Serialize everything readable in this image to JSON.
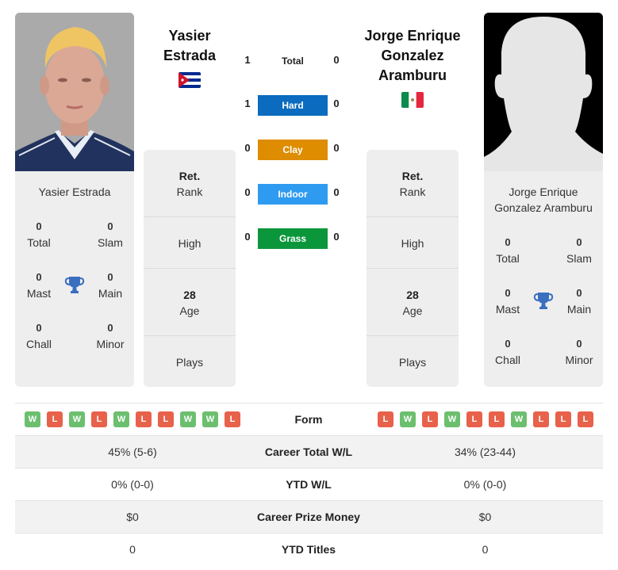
{
  "player1": {
    "name_header": "Yasier Estrada",
    "name_line1": "Yasier",
    "name_line2": "Estrada",
    "card_name": "Yasier Estrada",
    "country_flag": "cuba-flag",
    "titles": {
      "total": {
        "value": "0",
        "label": "Total"
      },
      "slam": {
        "value": "0",
        "label": "Slam"
      },
      "mast": {
        "value": "0",
        "label": "Mast"
      },
      "main": {
        "value": "0",
        "label": "Main"
      },
      "chall": {
        "value": "0",
        "label": "Chall"
      },
      "minor": {
        "value": "0",
        "label": "Minor"
      }
    },
    "info": {
      "rank_value": "Ret.",
      "rank_label": "Rank",
      "high_label": "High",
      "age_value": "28",
      "age_label": "Age",
      "plays_label": "Plays"
    },
    "form": [
      "W",
      "L",
      "W",
      "L",
      "W",
      "L",
      "L",
      "W",
      "W",
      "L"
    ]
  },
  "player2": {
    "name_line1": "Jorge Enrique",
    "name_line2": "Gonzalez",
    "name_line3": "Aramburu",
    "card_name_line1": "Jorge Enrique",
    "card_name_line2": "Gonzalez Aramburu",
    "country_flag": "mexico-flag",
    "titles": {
      "total": {
        "value": "0",
        "label": "Total"
      },
      "slam": {
        "value": "0",
        "label": "Slam"
      },
      "mast": {
        "value": "0",
        "label": "Mast"
      },
      "main": {
        "value": "0",
        "label": "Main"
      },
      "chall": {
        "value": "0",
        "label": "Chall"
      },
      "minor": {
        "value": "0",
        "label": "Minor"
      }
    },
    "info": {
      "rank_value": "Ret.",
      "rank_label": "Rank",
      "high_label": "High",
      "age_value": "28",
      "age_label": "Age",
      "plays_label": "Plays"
    },
    "form": [
      "L",
      "W",
      "L",
      "W",
      "L",
      "L",
      "W",
      "L",
      "L",
      "L"
    ]
  },
  "h2h": {
    "total": {
      "label": "Total",
      "p1": "1",
      "p2": "0"
    },
    "surfaces": [
      {
        "label": "Hard",
        "p1": "1",
        "p2": "0",
        "color": "#0a6bbf"
      },
      {
        "label": "Clay",
        "p1": "0",
        "p2": "0",
        "color": "#de8c00"
      },
      {
        "label": "Indoor",
        "p1": "0",
        "p2": "0",
        "color": "#2e9bf0"
      },
      {
        "label": "Grass",
        "p1": "0",
        "p2": "0",
        "color": "#0c963b"
      }
    ]
  },
  "comparison": {
    "form_label": "Form",
    "rows": [
      {
        "label": "Career Total W/L",
        "p1": "45% (5-6)",
        "p2": "34% (23-44)"
      },
      {
        "label": "YTD W/L",
        "p1": "0% (0-0)",
        "p2": "0% (0-0)"
      },
      {
        "label": "Career Prize Money",
        "p1": "$0",
        "p2": "$0"
      },
      {
        "label": "YTD Titles",
        "p1": "0",
        "p2": "0"
      }
    ]
  },
  "colors": {
    "win": "#6cbf6f",
    "loss": "#e8614a",
    "trophy": "#3a6fbf",
    "card_bg": "#eeeeee"
  }
}
